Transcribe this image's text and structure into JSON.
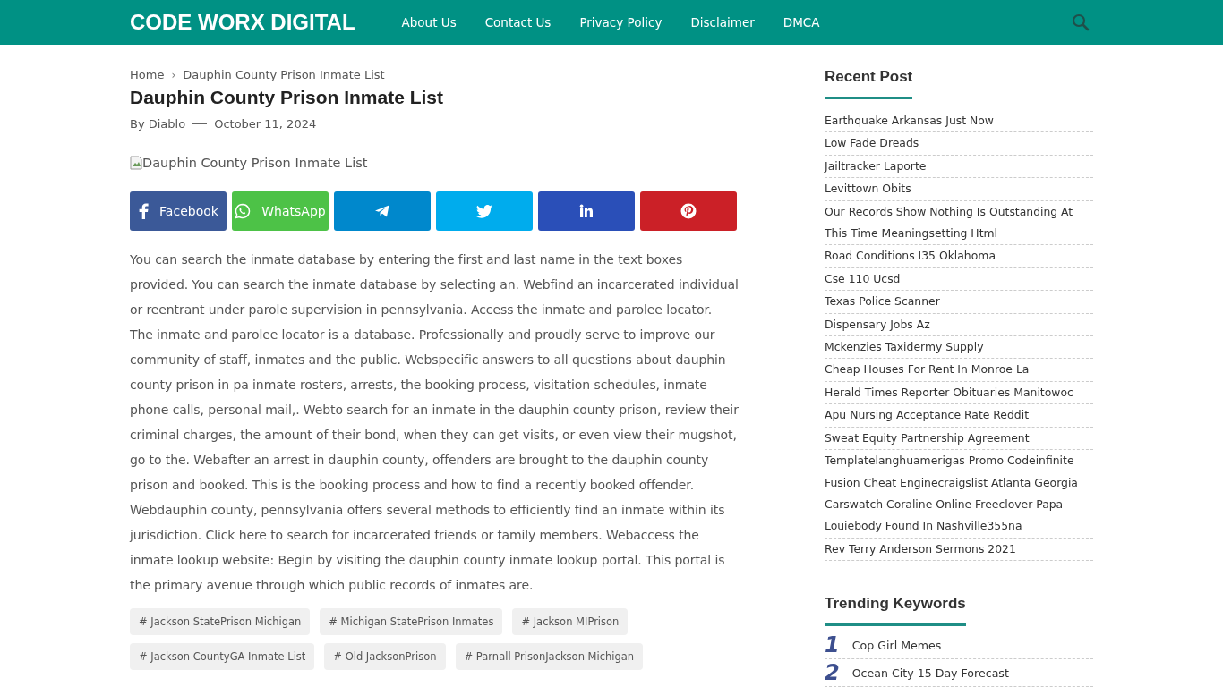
{
  "header": {
    "logo": "CODE WORX DIGITAL",
    "nav": [
      "About Us",
      "Contact Us",
      "Privacy Policy",
      "Disclaimer",
      "DMCA"
    ]
  },
  "breadcrumb": {
    "items": [
      "Home",
      "Dauphin County Prison Inmate List"
    ],
    "separator": "›"
  },
  "article": {
    "title": "Dauphin County Prison Inmate List",
    "author": "By Diablo",
    "date": "October 11, 2024",
    "image_alt": "Dauphin County Prison Inmate List",
    "share": [
      {
        "kind": "facebook",
        "label": "Facebook",
        "color": "#3b5998"
      },
      {
        "kind": "whatsapp",
        "label": "WhatsApp",
        "color": "#4dc247"
      },
      {
        "kind": "telegram",
        "color": "#0088cc"
      },
      {
        "kind": "twitter",
        "color": "#00aced"
      },
      {
        "kind": "linkedin",
        "color": "#2a4fb8"
      },
      {
        "kind": "pinterest",
        "color": "#cb2027"
      }
    ],
    "body": "You can search the inmate database by entering the first and last name in the text boxes provided. You can search the inmate database by selecting an. Webfind an incarcerated individual or reentrant under parole supervision in pennsylvania. Access the inmate and parolee locator. The inmate and parolee locator is a database. Professionally and proudly serve to improve our community of staff, inmates and the public. Webspecific answers to all questions about dauphin county prison in pa inmate rosters, arrests, the booking process, visitation schedules, inmate phone calls, personal mail,. Webto search for an inmate in the dauphin county prison, review their criminal charges, the amount of their bond, when they can get visits, or even view their mugshot, go to the. Webafter an arrest in dauphin county, offenders are brought to the dauphin county prison and booked. This is the booking process and how to find a recently booked offender. Webdauphin county, pennsylvania offers several methods to efficiently find an inmate within its jurisdiction. Click here to search for incarcerated friends or family members. Webaccess the inmate lookup website: Begin by visiting the dauphin county inmate lookup portal. This portal is the primary avenue through which public records of inmates are.",
    "tags": [
      "# Jackson StatePrison Michigan",
      "# Michigan StatePrison Inmates",
      "# Jackson MIPrison",
      "# Jackson CountyGA Inmate List",
      "# Old JacksonPrison",
      "# Parnall PrisonJackson Michigan"
    ]
  },
  "sidebar": {
    "recent_title": "Recent Post",
    "recent": [
      "Earthquake Arkansas Just Now",
      "Low Fade Dreads",
      "Jailtracker Laporte",
      "Levittown Obits",
      "Our Records Show Nothing Is Outstanding At This Time Meaningsetting Html",
      "Road Conditions I35 Oklahoma",
      "Cse 110 Ucsd",
      "Texas Police Scanner",
      "Dispensary Jobs Az",
      "Mckenzies Taxidermy Supply",
      "Cheap Houses For Rent In Monroe La",
      "Herald Times Reporter Obituaries Manitowoc",
      "Apu Nursing Acceptance Rate Reddit",
      "Sweat Equity Partnership Agreement",
      "Templatelanghuamerigas Promo Codeinfinite Fusion Cheat Enginecraigslist Atlanta Georgia Carswatch Coraline Online Freeclover Papa Louiebody Found In Nashville355na",
      "Rev Terry Anderson Sermons 2021"
    ],
    "trending_title": "Trending Keywords",
    "trending": [
      {
        "rank": "1",
        "label": "Cop Girl Memes"
      },
      {
        "rank": "2",
        "label": "Ocean City 15 Day Forecast"
      }
    ]
  }
}
